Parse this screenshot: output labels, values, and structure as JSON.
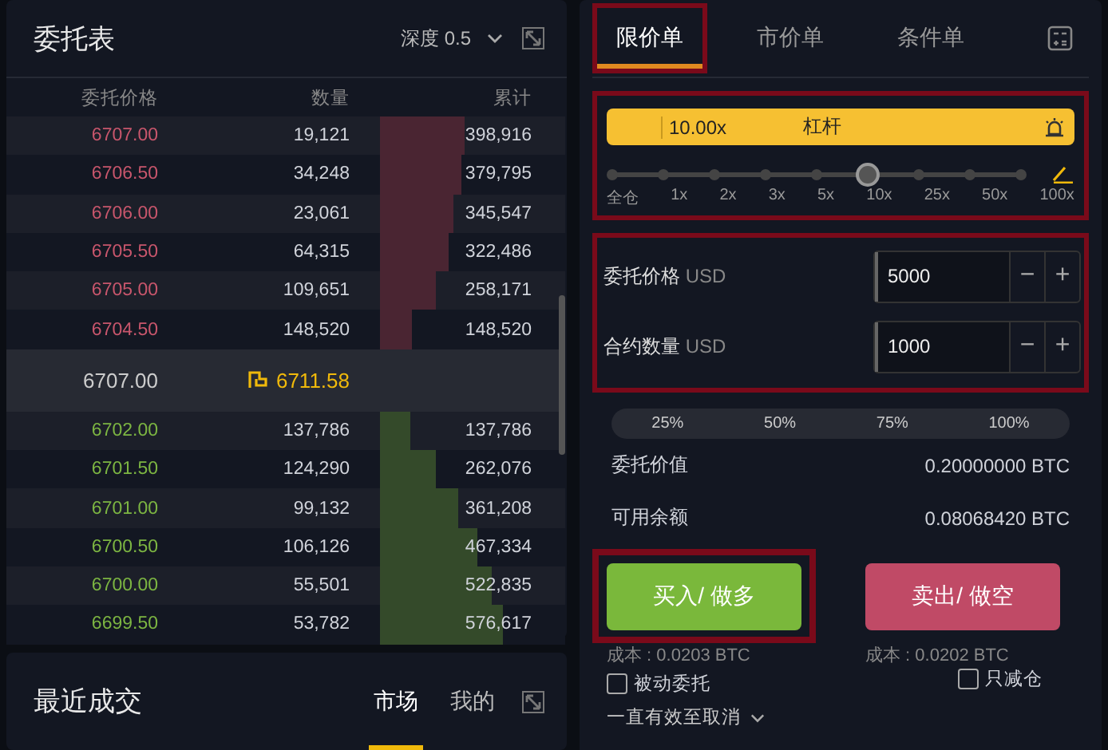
{
  "order_book": {
    "title": "委托表",
    "depth_label": "深度 0.5",
    "columns": [
      "委托价格",
      "数量",
      "累计"
    ],
    "asks": [
      {
        "price": "6707.00",
        "amount": "19,121",
        "total": "398,916",
        "level": 0.46
      },
      {
        "price": "6706.50",
        "amount": "34,248",
        "total": "379,795",
        "level": 0.44
      },
      {
        "price": "6706.00",
        "amount": "23,061",
        "total": "345,547",
        "level": 0.4
      },
      {
        "price": "6705.50",
        "amount": "64,315",
        "total": "322,486",
        "level": 0.37
      },
      {
        "price": "6705.00",
        "amount": "109,651",
        "total": "258,171",
        "level": 0.3
      },
      {
        "price": "6704.50",
        "amount": "148,520",
        "total": "148,520",
        "level": 0.17
      }
    ],
    "mid": {
      "last_price": "6707.00",
      "mark_price": "6711.58"
    },
    "bids": [
      {
        "price": "6702.00",
        "amount": "137,786",
        "total": "137,786",
        "level": 0.16
      },
      {
        "price": "6701.50",
        "amount": "124,290",
        "total": "262,076",
        "level": 0.3
      },
      {
        "price": "6701.00",
        "amount": "99,132",
        "total": "361,208",
        "level": 0.42
      },
      {
        "price": "6700.50",
        "amount": "106,126",
        "total": "467,334",
        "level": 0.53
      },
      {
        "price": "6700.00",
        "amount": "55,501",
        "total": "522,835",
        "level": 0.6
      },
      {
        "price": "6699.50",
        "amount": "53,782",
        "total": "576,617",
        "level": 0.66
      }
    ]
  },
  "recent_trades": {
    "title": "最近成交",
    "tabs": [
      {
        "label": "市场",
        "selected": true
      },
      {
        "label": "我的",
        "selected": false
      }
    ]
  },
  "order_form": {
    "tabs": [
      {
        "label": "限价单",
        "selected": true,
        "highlighted": true
      },
      {
        "label": "市价单",
        "selected": false,
        "highlighted": false
      },
      {
        "label": "条件单",
        "selected": false,
        "highlighted": false
      }
    ],
    "leverage": {
      "highlighted": true,
      "value": "10.00x",
      "label": "杠杆",
      "level": 0.625,
      "marks": [
        "全仓",
        "1x",
        "2x",
        "3x",
        "5x",
        "10x",
        "25x",
        "50x",
        "100x"
      ]
    },
    "inputs_highlighted": true,
    "inputs": [
      {
        "label": "委托价格",
        "unit": "USD",
        "value": "5000"
      },
      {
        "label": "合约数量",
        "unit": "USD",
        "value": "1000"
      }
    ],
    "stepper": {
      "minus": "−",
      "plus": "+"
    },
    "percents": [
      "25%",
      "50%",
      "75%",
      "100%"
    ],
    "info": [
      {
        "label": "委托价值",
        "value": "0.20000000 BTC"
      },
      {
        "label": "可用余额",
        "value": "0.08068420 BTC"
      }
    ],
    "buttons": [
      {
        "kind": "buy",
        "label": "买入/ 做多",
        "highlighted": true,
        "cost": "成本 : 0.0203 BTC"
      },
      {
        "kind": "sell",
        "label": "卖出/ 做空",
        "highlighted": false,
        "cost": "成本 : 0.0202 BTC"
      }
    ],
    "checkboxes": [
      {
        "label": "被动委托",
        "checked": false
      },
      {
        "label": "只减仓",
        "checked": false
      }
    ],
    "time_in_force": "一直有效至取消"
  }
}
